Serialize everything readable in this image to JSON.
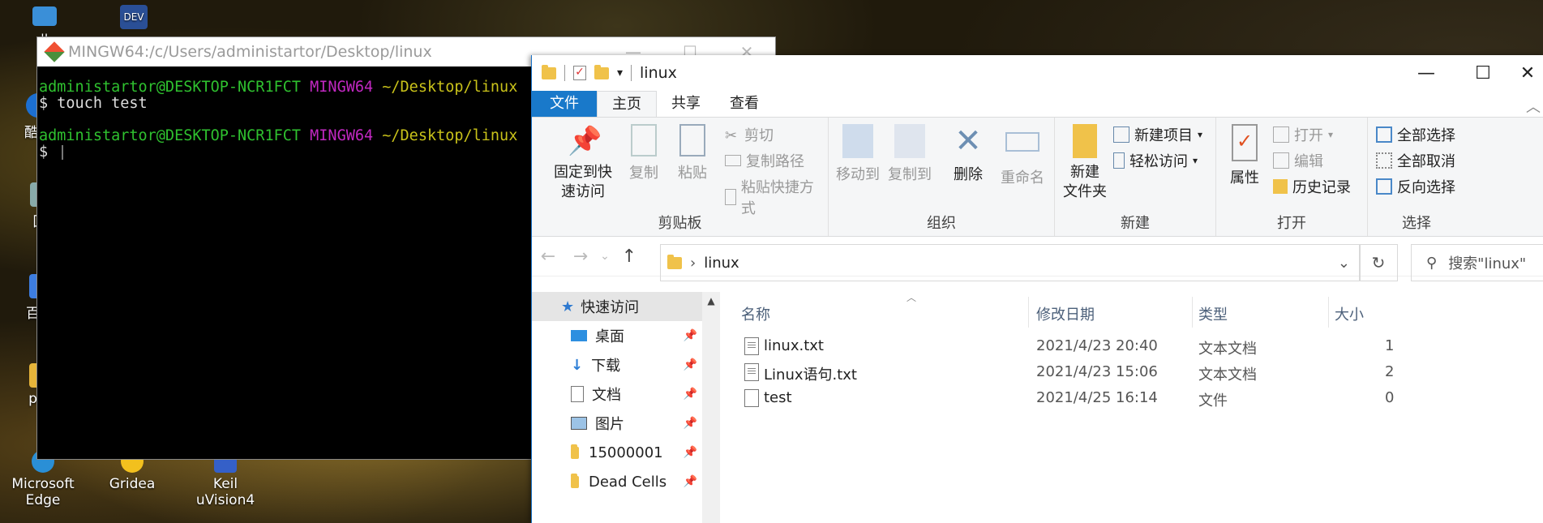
{
  "desktop": {
    "icons": [
      {
        "label": "此",
        "name": "this-pc"
      },
      {
        "label": "酷狗",
        "name": "kugou"
      },
      {
        "label": "回",
        "name": "recycle-bin"
      },
      {
        "label": "百度",
        "name": "baidu"
      },
      {
        "label": "pro",
        "name": "pro"
      },
      {
        "label": "Microsoft Edge",
        "name": "microsoft-edge"
      },
      {
        "label": "Gridea",
        "name": "gridea"
      },
      {
        "label": "Keil uVision4",
        "name": "keil"
      }
    ],
    "top_icon": "DEV"
  },
  "terminal": {
    "title": "MINGW64:/c/Users/administartor/Desktop/linux",
    "lines": [
      {
        "user": "administartor@DESKTOP-NCR1FCT",
        "sys": "MINGW64",
        "path": "~/Desktop/linux"
      },
      {
        "cmd": "$ touch test"
      },
      {
        "user": "administartor@DESKTOP-NCR1FCT",
        "sys": "MINGW64",
        "path": "~/Desktop/linux"
      },
      {
        "cmd": "$ "
      }
    ]
  },
  "explorer": {
    "title": "linux",
    "tabs": {
      "file": "文件",
      "home": "主页",
      "share": "共享",
      "view": "查看"
    },
    "ribbon": {
      "clipboard": {
        "label": "剪贴板",
        "pin": "固定到快\n速访问",
        "copy": "复制",
        "paste": "粘贴",
        "cut": "剪切",
        "copy_path": "复制路径",
        "paste_shortcut": "粘贴快捷方式"
      },
      "organize": {
        "label": "组织",
        "move_to": "移动到",
        "copy_to": "复制到",
        "delete": "删除",
        "rename": "重命名"
      },
      "new": {
        "label": "新建",
        "new_folder": "新建\n文件夹",
        "new_item": "新建项目",
        "easy_access": "轻松访问"
      },
      "open": {
        "label": "打开",
        "properties": "属性",
        "open": "打开",
        "edit": "编辑",
        "history": "历史记录"
      },
      "select": {
        "label": "选择",
        "select_all": "全部选择",
        "select_none": "全部取消",
        "invert": "反向选择"
      }
    },
    "address": "linux",
    "search_placeholder": "搜索\"linux\"",
    "nav": [
      {
        "label": "快速访问",
        "selected": true
      },
      {
        "label": "桌面",
        "pinned": true
      },
      {
        "label": "下载",
        "pinned": true
      },
      {
        "label": "文档",
        "pinned": true
      },
      {
        "label": "图片",
        "pinned": true
      },
      {
        "label": "15000001",
        "pinned": true
      },
      {
        "label": "Dead Cells",
        "pinned": true
      }
    ],
    "columns": {
      "name": "名称",
      "modified": "修改日期",
      "type": "类型",
      "size": "大小"
    },
    "files": [
      {
        "name": "linux.txt",
        "modified": "2021/4/23 20:40",
        "type": "文本文档",
        "size": "1"
      },
      {
        "name": "Linux语句.txt",
        "modified": "2021/4/23 15:06",
        "type": "文本文档",
        "size": "2"
      },
      {
        "name": "test",
        "modified": "2021/4/25 16:14",
        "type": "文件",
        "size": "0"
      }
    ]
  }
}
